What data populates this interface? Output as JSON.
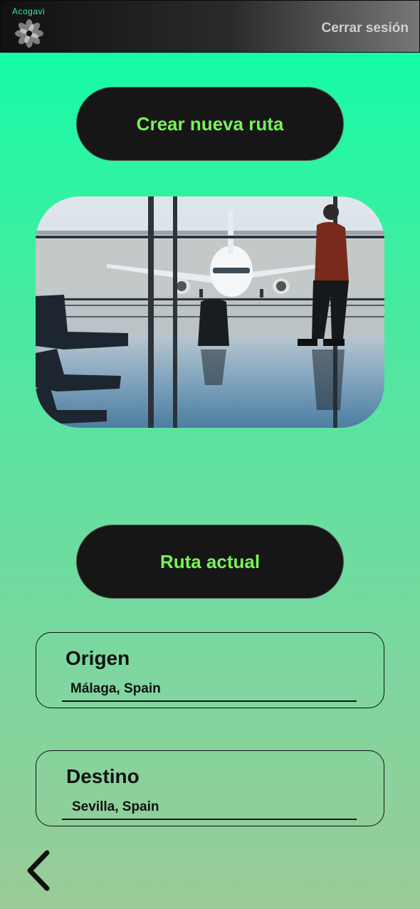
{
  "header": {
    "brand": "Acogavi",
    "logo_icon": "flower-logo-icon",
    "logout_label": "Cerrar sesión"
  },
  "main": {
    "create_route_label": "Crear nueva ruta",
    "current_route_label": "Ruta actual",
    "origin": {
      "label": "Origen",
      "value": "Málaga, Spain"
    },
    "destination": {
      "label": "Destino",
      "value": "Sevilla, Spain"
    }
  },
  "nav": {
    "back_icon": "chevron-left-icon"
  },
  "colors": {
    "accent_text": "#78f25a",
    "button_bg": "#171616",
    "bg_top": "#0bffa6",
    "bg_bottom": "#9acb98"
  }
}
